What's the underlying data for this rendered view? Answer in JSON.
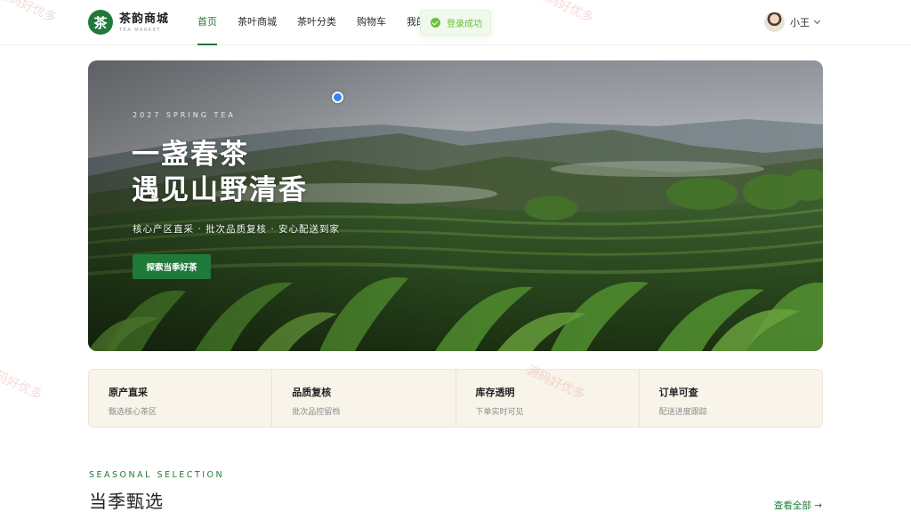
{
  "brand": {
    "badge": "茶",
    "title": "茶韵商城",
    "subtitle": "TEA MARKET"
  },
  "nav": {
    "items": [
      {
        "label": "首页",
        "active": true
      },
      {
        "label": "茶叶商城"
      },
      {
        "label": "茶叶分类"
      },
      {
        "label": "购物车"
      },
      {
        "label": "我的"
      }
    ]
  },
  "toast": {
    "text": "登录成功",
    "icon": "check-circle-icon"
  },
  "user": {
    "name": "小王"
  },
  "hero": {
    "eyebrow": "2027 SPRING TEA",
    "title_line1": "一盏春茶",
    "title_line2": "遇见山野清香",
    "desc": "核心产区直采 · 批次品质复核 · 安心配送到家",
    "cta": "探索当季好茶"
  },
  "features": [
    {
      "title": "原产直采",
      "desc": "甄选核心茶区"
    },
    {
      "title": "品质复核",
      "desc": "批次品控留档"
    },
    {
      "title": "库存透明",
      "desc": "下单实时可见"
    },
    {
      "title": "订单可查",
      "desc": "配送进度跟踪"
    }
  ],
  "section": {
    "eyebrow": "SEASONAL SELECTION",
    "title": "当季甄选",
    "link": "查看全部 →"
  },
  "watermark": "源码好优多",
  "colors": {
    "accent": "#1f7a3a",
    "success": "#67c23a",
    "feature_bg": "#f8f4ea"
  }
}
